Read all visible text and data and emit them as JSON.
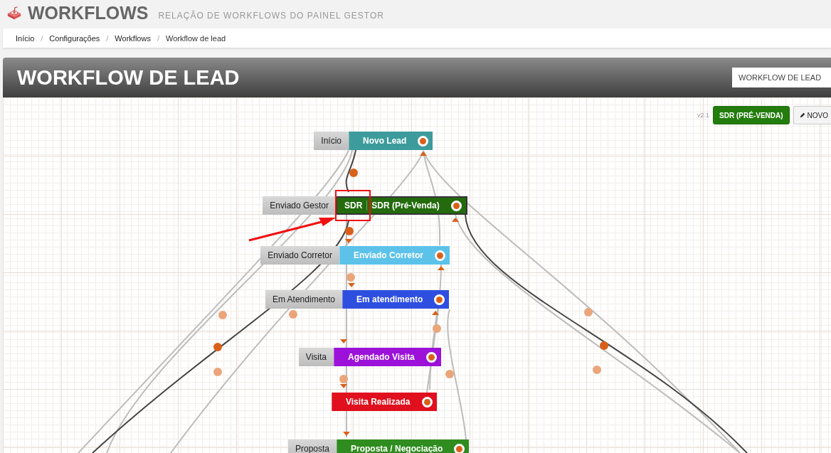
{
  "page_header": {
    "title": "WORKFLOWS",
    "subtitle": "RELAÇÃO DE WORKFLOWS DO PAINEL GESTOR"
  },
  "breadcrumb": [
    "Início",
    "Configurações",
    "Workflows",
    "Workflow de lead"
  ],
  "breadcrumb_separator": "/",
  "panel": {
    "title": "WORKFLOW DE LEAD",
    "workflow_select": "WORKFLOW DE LEAD"
  },
  "toolbar": {
    "version": "v2.1",
    "buttons": [
      {
        "label": "SDR (PRÉ-VENDA)",
        "kind": "primary"
      },
      {
        "label": "NOVO",
        "kind": "edit"
      }
    ]
  },
  "nodes": [
    {
      "tag": "Início",
      "label": "Novo Lead",
      "color": "#3d9b9b"
    },
    {
      "tag": "Enviado Gestor",
      "prefix": "SDR",
      "label": "SDR (Pré-Venda)",
      "color": "#236b0d"
    },
    {
      "tag": "Enviado Corretor",
      "label": "Enviado Corretor",
      "color": "#5cc2ea"
    },
    {
      "tag": "Em Atendimento",
      "label": "Em atendimento",
      "color": "#2e4ee0"
    },
    {
      "tag": "Visita",
      "label": "Agendado Visita",
      "color": "#9c12d8"
    },
    {
      "label": "Visita Realizada",
      "color": "#e0101e"
    },
    {
      "tag": "Proposta",
      "label": "Proposta / Negociação",
      "color": "#2f8c1f"
    }
  ]
}
